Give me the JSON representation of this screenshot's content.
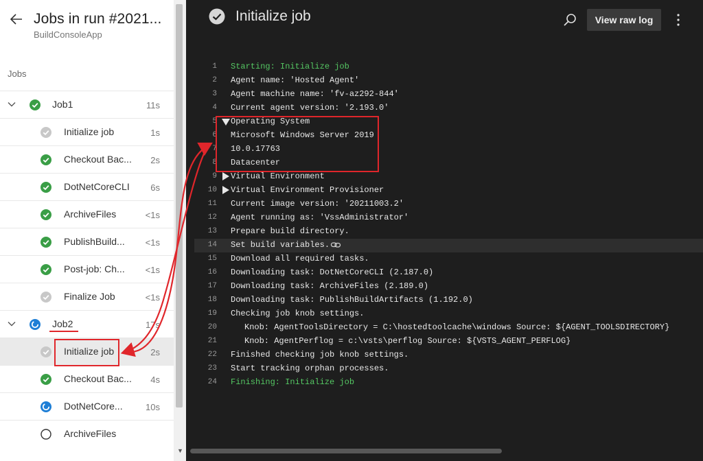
{
  "header": {
    "title": "Jobs in run #2021...",
    "subtitle": "BuildConsoleApp",
    "section_label": "Jobs"
  },
  "jobs": [
    {
      "kind": "job",
      "name": "Job1",
      "duration": "11s",
      "status": "success",
      "expanded": true
    },
    {
      "kind": "step",
      "name": "Initialize job",
      "duration": "1s",
      "status": "skipped"
    },
    {
      "kind": "step",
      "name": "Checkout Bac...",
      "duration": "2s",
      "status": "success"
    },
    {
      "kind": "step",
      "name": "DotNetCoreCLI",
      "duration": "6s",
      "status": "success"
    },
    {
      "kind": "step",
      "name": "ArchiveFiles",
      "duration": "<1s",
      "status": "success"
    },
    {
      "kind": "step",
      "name": "PublishBuild...",
      "duration": "<1s",
      "status": "success"
    },
    {
      "kind": "step",
      "name": "Post-job: Ch...",
      "duration": "<1s",
      "status": "success"
    },
    {
      "kind": "step",
      "name": "Finalize Job",
      "duration": "<1s",
      "status": "skipped"
    },
    {
      "kind": "job",
      "name": "Job2",
      "duration": "17s",
      "status": "running",
      "expanded": true
    },
    {
      "kind": "step",
      "name": "Initialize job",
      "duration": "2s",
      "status": "skipped",
      "selected": true
    },
    {
      "kind": "step",
      "name": "Checkout Bac...",
      "duration": "4s",
      "status": "success"
    },
    {
      "kind": "step",
      "name": "DotNetCore...",
      "duration": "10s",
      "status": "running"
    },
    {
      "kind": "step",
      "name": "ArchiveFiles",
      "duration": "",
      "status": "pending"
    }
  ],
  "step_view": {
    "title": "Initialize job",
    "raw_log_label": "View raw log"
  },
  "log_lines": [
    {
      "n": "1",
      "text": "Starting: Initialize job",
      "style": "green"
    },
    {
      "n": "2",
      "text": "Agent name: 'Hosted Agent'"
    },
    {
      "n": "3",
      "text": "Agent machine name: 'fv-az292-844'"
    },
    {
      "n": "4",
      "text": "Current agent version: '2.193.0'"
    },
    {
      "n": "5",
      "text": "Operating System",
      "toggle": "down"
    },
    {
      "n": "6",
      "text": "Microsoft Windows Server 2019"
    },
    {
      "n": "7",
      "text": "10.0.17763"
    },
    {
      "n": "8",
      "text": "Datacenter"
    },
    {
      "n": "9",
      "text": "Virtual Environment",
      "toggle": "right"
    },
    {
      "n": "10",
      "text": "Virtual Environment Provisioner",
      "toggle": "right"
    },
    {
      "n": "11",
      "text": "Current image version: '20211003.2'"
    },
    {
      "n": "12",
      "text": "Agent running as: 'VssAdministrator'"
    },
    {
      "n": "13",
      "text": "Prepare build directory."
    },
    {
      "n": "14",
      "text": "Set build variables.",
      "highlight": true
    },
    {
      "n": "15",
      "text": "Download all required tasks."
    },
    {
      "n": "16",
      "text": "Downloading task: DotNetCoreCLI (2.187.0)"
    },
    {
      "n": "17",
      "text": "Downloading task: ArchiveFiles (2.189.0)"
    },
    {
      "n": "18",
      "text": "Downloading task: PublishBuildArtifacts (1.192.0)"
    },
    {
      "n": "19",
      "text": "Checking job knob settings."
    },
    {
      "n": "20",
      "text": "Knob: AgentToolsDirectory = C:\\hostedtoolcache\\windows Source: ${AGENT_TOOLSDIRECTORY}",
      "indent": true
    },
    {
      "n": "21",
      "text": "Knob: AgentPerflog = c:\\vsts\\perflog Source: ${VSTS_AGENT_PERFLOG}",
      "indent": true
    },
    {
      "n": "22",
      "text": "Finished checking job knob settings."
    },
    {
      "n": "23",
      "text": "Start tracking orphan processes."
    },
    {
      "n": "24",
      "text": "Finishing: Initialize job",
      "style": "green"
    }
  ],
  "colors": {
    "success": "#3a9e46",
    "running": "#1f7fd6",
    "skipped": "#c8c8c8",
    "annotation": "#e0262b",
    "log_green": "#55c763"
  }
}
